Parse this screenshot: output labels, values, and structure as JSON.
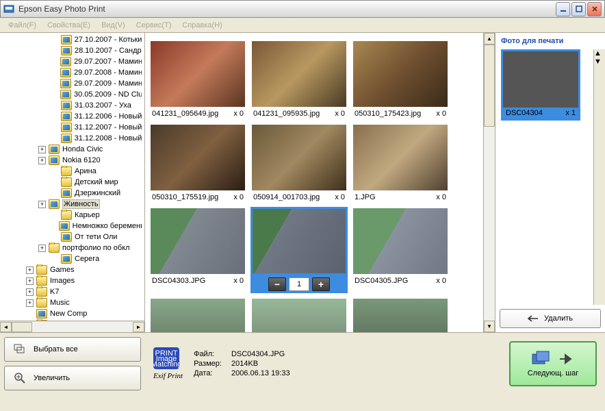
{
  "window": {
    "title": "Epson Easy Photo Print"
  },
  "menu": [
    "Файл(F)",
    "Свойства(E)",
    "Вид(V)",
    "Сервис(T)",
    "Справка(H)"
  ],
  "tree": [
    {
      "depth": 3,
      "exp": "",
      "kind": "p",
      "label": "27.10.2007 - Котьки"
    },
    {
      "depth": 3,
      "exp": "",
      "kind": "p",
      "label": "28.10.2007 - Сандр"
    },
    {
      "depth": 3,
      "exp": "",
      "kind": "p",
      "label": "29.07.2007 - Мамин"
    },
    {
      "depth": 3,
      "exp": "",
      "kind": "p",
      "label": "29.07.2008 - Мамин"
    },
    {
      "depth": 3,
      "exp": "",
      "kind": "p",
      "label": "29.07.2009 - Мамин"
    },
    {
      "depth": 3,
      "exp": "",
      "kind": "p",
      "label": "30.05.2009 - ND Clu"
    },
    {
      "depth": 3,
      "exp": "",
      "kind": "p",
      "label": "31.03.2007 - Уха"
    },
    {
      "depth": 3,
      "exp": "",
      "kind": "p",
      "label": "31.12.2006 - Новый"
    },
    {
      "depth": 3,
      "exp": "",
      "kind": "p",
      "label": "31.12.2007 - Новый"
    },
    {
      "depth": 3,
      "exp": "",
      "kind": "p",
      "label": "31.12.2008 - Новый"
    },
    {
      "depth": 2,
      "exp": "+",
      "kind": "p",
      "label": "Honda Civic"
    },
    {
      "depth": 2,
      "exp": "+",
      "kind": "p",
      "label": "Nokia 6120"
    },
    {
      "depth": 3,
      "exp": "",
      "kind": "y",
      "label": "Арина"
    },
    {
      "depth": 3,
      "exp": "",
      "kind": "y",
      "label": "Детский мир"
    },
    {
      "depth": 3,
      "exp": "",
      "kind": "p",
      "label": "Дзержинский"
    },
    {
      "depth": 2,
      "exp": "+",
      "kind": "p",
      "label": "Живность",
      "selected": true
    },
    {
      "depth": 3,
      "exp": "",
      "kind": "y",
      "label": "Карьер"
    },
    {
      "depth": 3,
      "exp": "",
      "kind": "p",
      "label": "Немножко беременн"
    },
    {
      "depth": 3,
      "exp": "",
      "kind": "p",
      "label": "От тети Оли"
    },
    {
      "depth": 2,
      "exp": "+",
      "kind": "y",
      "label": "портфолио по обкл"
    },
    {
      "depth": 3,
      "exp": "",
      "kind": "p",
      "label": "Серега"
    },
    {
      "depth": 1,
      "exp": "+",
      "kind": "y",
      "label": "Games"
    },
    {
      "depth": 1,
      "exp": "+",
      "kind": "y",
      "label": "Images"
    },
    {
      "depth": 1,
      "exp": "+",
      "kind": "y",
      "label": "K7"
    },
    {
      "depth": 1,
      "exp": "+",
      "kind": "y",
      "label": "Music"
    },
    {
      "depth": 1,
      "exp": "",
      "kind": "p",
      "label": "New Comp"
    },
    {
      "depth": 1,
      "exp": "+",
      "kind": "y",
      "label": "Programs"
    }
  ],
  "thumbs": [
    {
      "name": "041231_095649.jpg",
      "count": "x 0",
      "cls": "cat1"
    },
    {
      "name": "041231_095935.jpg",
      "count": "x 0",
      "cls": "cat2"
    },
    {
      "name": "050310_175423.jpg",
      "count": "x 0",
      "cls": "cat3"
    },
    {
      "name": "050310_175519.jpg",
      "count": "x 0",
      "cls": "cat4"
    },
    {
      "name": "050914_001703.jpg",
      "count": "x 0",
      "cls": "cat5"
    },
    {
      "name": "1.JPG",
      "count": "x 0",
      "cls": "cat6"
    },
    {
      "name": "DSC04303.JPG",
      "count": "x 0",
      "cls": "bird1"
    },
    {
      "name": "DSC04304.JPG",
      "count": "",
      "cls": "bird2",
      "selected": true,
      "qty": "1"
    },
    {
      "name": "DSC04305.JPG",
      "count": "x 0",
      "cls": "bird3"
    },
    {
      "name": "",
      "count": "",
      "cls": "g1"
    },
    {
      "name": "",
      "count": "",
      "cls": "g2"
    },
    {
      "name": "",
      "count": "",
      "cls": "g3"
    }
  ],
  "printPanel": {
    "header": "Фото для печати",
    "item": {
      "name": "DSC04304",
      "count": "x 1"
    },
    "deleteLabel": "Удалить"
  },
  "buttons": {
    "selectAll": "Выбрать все",
    "zoom": "Увеличить"
  },
  "info": {
    "fileLabel": "Файл:",
    "fileVal": "DSC04304.JPG",
    "sizeLabel": "Размер:",
    "sizeVal": "2014KB",
    "dateLabel": "Дата:",
    "dateVal": "2006.06.13 19:33",
    "exif": "Exif Print"
  },
  "next": {
    "label": "Следующ. шаг"
  }
}
